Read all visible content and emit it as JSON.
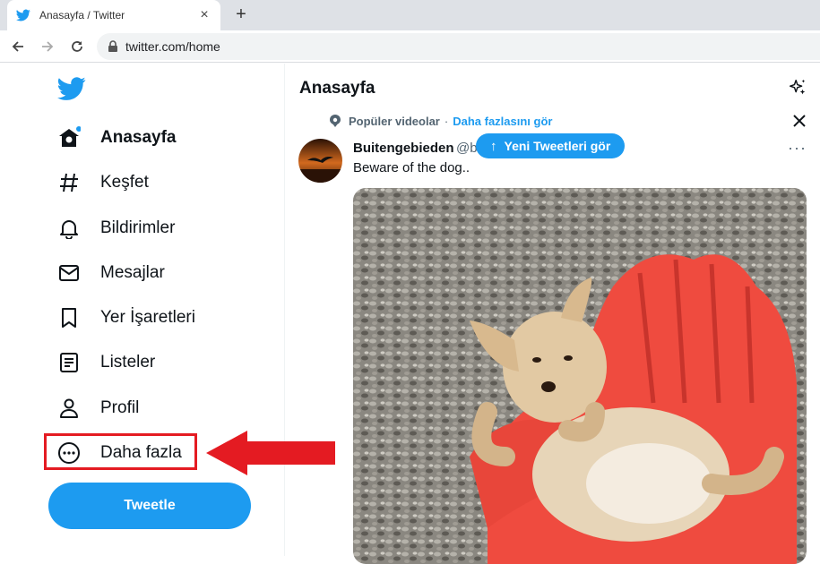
{
  "browser": {
    "tab_title": "Anasayfa / Twitter",
    "close_symbol": "×",
    "new_tab_symbol": "+",
    "url": "twitter.com/home"
  },
  "sidebar": {
    "items": [
      {
        "label": "Anasayfa",
        "icon": "home-icon"
      },
      {
        "label": "Keşfet",
        "icon": "hashtag-icon"
      },
      {
        "label": "Bildirimler",
        "icon": "bell-icon"
      },
      {
        "label": "Mesajlar",
        "icon": "envelope-icon"
      },
      {
        "label": "Yer İşaretleri",
        "icon": "bookmark-icon"
      },
      {
        "label": "Listeler",
        "icon": "list-icon"
      },
      {
        "label": "Profil",
        "icon": "person-icon"
      },
      {
        "label": "Daha fazla",
        "icon": "more-circle-icon"
      }
    ],
    "tweet_button": "Tweetle"
  },
  "main": {
    "title": "Anasayfa",
    "popular_label": "Popüler videolar",
    "separator": "·",
    "see_more": "Daha fazlasını gör",
    "new_tweets": "Yeni Tweetleri gör",
    "tweet": {
      "author": "Buitengebieden",
      "handle": "@b",
      "text": "Beware of the dog..",
      "more_symbol": "···"
    }
  },
  "colors": {
    "accent": "#1d9bf0",
    "annotation_red": "#e41b22",
    "text": "#0f1419",
    "muted": "#536471"
  }
}
